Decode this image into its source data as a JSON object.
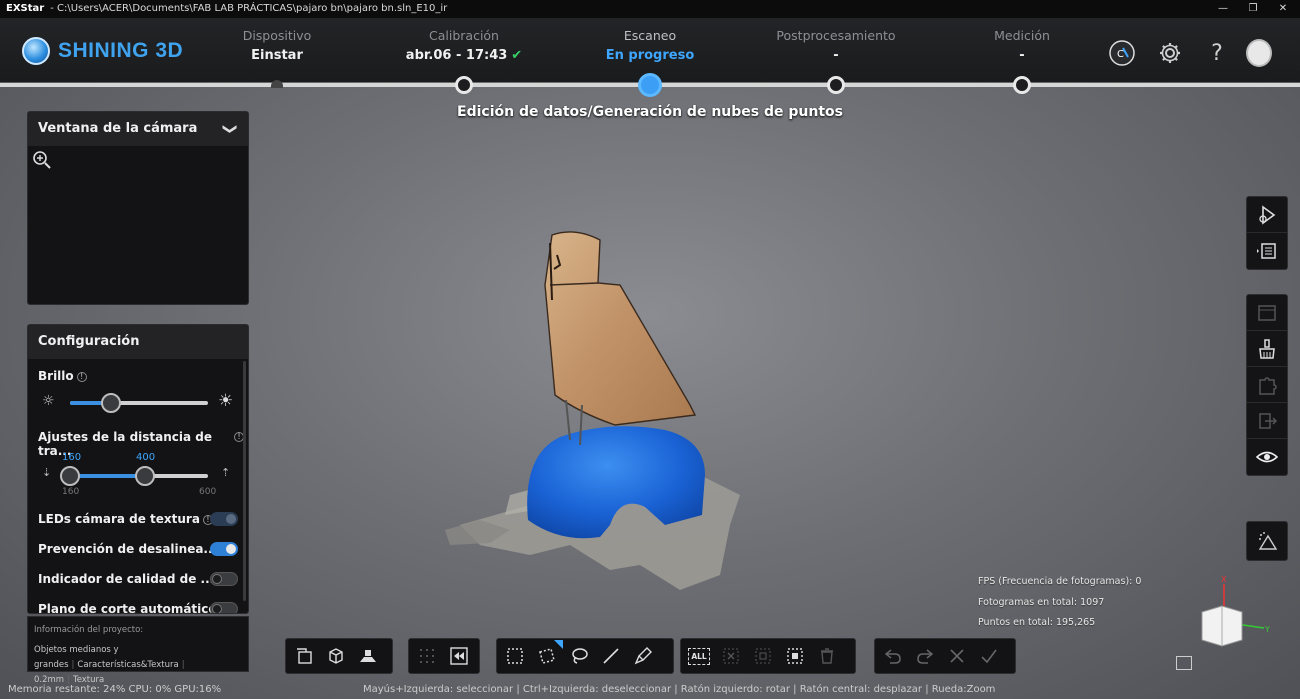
{
  "titlebar": {
    "app": "EXStar",
    "path": "-  C:\\Users\\ACER\\Documents\\FAB LAB PRÁCTICAS\\pajaro bn\\pajaro bn.sln_E10_ir",
    "min": "—",
    "max": "❐",
    "close": "✕"
  },
  "header": {
    "logo_text": "SHINING 3D",
    "steps": [
      {
        "label": "Dispositivo",
        "value": "Einstar"
      },
      {
        "label": "Calibración",
        "value": "abr.06 - 17:43"
      },
      {
        "label": "Escaneo",
        "value": "En progreso"
      },
      {
        "label": "Postprocesamiento",
        "value": "-"
      },
      {
        "label": "Medición",
        "value": "-"
      }
    ],
    "icons": [
      "cx-logo-icon",
      "gear-icon",
      "help-icon",
      "user-avatar-icon"
    ],
    "help_glyph": "?"
  },
  "subtitle": "Edición de datos/Generación de nubes de puntos",
  "camera": {
    "title": "Ventana de la cámara",
    "chevron": "❯"
  },
  "config": {
    "title": "Configuración",
    "brightness_label": "Brillo",
    "brightness_level": 0.3,
    "distance_label": "Ajustes de la distancia de tra...",
    "distance_low": "160",
    "distance_high": "400",
    "distance_min": "160",
    "distance_max": "600",
    "leds_label": "LEDs cámara de textura",
    "prevent_label": "Prevención de desalinea...",
    "quality_label": "Indicador de calidad de ...",
    "plane_label": "Plano de corte automático",
    "info_glyph": "!"
  },
  "project": {
    "title": "Información del proyecto:",
    "size": "Objetos medianos y grandes",
    "features": "Características&Textura",
    "resolution": "0.2mm",
    "texture": "Textura",
    "separator": "|"
  },
  "stats": {
    "fps": "FPS (Frecuencia de fotogramas): 0",
    "frames": "Fotogramas en total: 1097",
    "points": "Puntos en total: 195,265"
  },
  "status": {
    "left": "Memoria restante: 24% CPU: 0% GPU:16%",
    "center": "Mayús+Izquierda: seleccionar | Ctrl+Izquierda: deseleccionar | Ratón izquierdo: rotar | Ratón central: desplazar | Rueda:Zoom"
  },
  "toolbar": {
    "all_label": "ALL"
  },
  "colors": {
    "accent": "#3ea6ff",
    "logo": "#3fa3ef",
    "check": "#37d067",
    "model_blue": "#1f6fe0",
    "wood": "#c49a6c"
  }
}
